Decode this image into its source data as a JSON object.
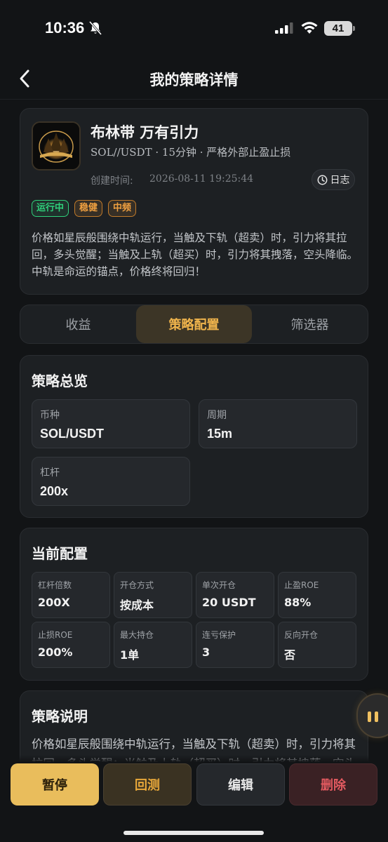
{
  "status_bar": {
    "time": "10:36",
    "battery": "41"
  },
  "nav": {
    "title": "我的策略详情"
  },
  "hero": {
    "title": "布林带 万有引力",
    "subtitle": "SOL//USDT · 15分钟 · 严格外部止盈止损",
    "created_label": "创建时间:",
    "created_value": "2026-08-11 19:25:44",
    "log_label": "日志",
    "tags": [
      "运行中",
      "稳健",
      "中频"
    ],
    "description": "价格如星辰般围绕中轨运行，当触及下轨（超卖）时，引力将其拉回，多头觉醒；当触及上轨（超买）时，引力将其拽落，空头降临。中轨是命运的锚点，价格终将回归！"
  },
  "tabs": [
    "收益",
    "策略配置",
    "筛选器"
  ],
  "overview": {
    "title": "策略总览",
    "items": [
      {
        "label": "币种",
        "value": "SOL/USDT"
      },
      {
        "label": "周期",
        "value": "15m"
      },
      {
        "label": "杠杆",
        "value": "200x"
      }
    ]
  },
  "config": {
    "title": "当前配置",
    "items": [
      {
        "label": "杠杆倍数",
        "value": "200X"
      },
      {
        "label": "开仓方式",
        "value": "按成本"
      },
      {
        "label": "单次开仓",
        "value": "20 USDT"
      },
      {
        "label": "止盈ROE",
        "value": "88%"
      },
      {
        "label": "止损ROE",
        "value": "200%"
      },
      {
        "label": "最大持仓",
        "value": "1单"
      },
      {
        "label": "连亏保护",
        "value": "3"
      },
      {
        "label": "反向开仓",
        "value": "否"
      }
    ]
  },
  "explain": {
    "title": "策略说明",
    "description": "价格如星辰般围绕中轨运行，当触及下轨（超卖）时，引力将其拉回，多头觉醒；当触及上轨（超买）时，引力将其拽落，空头降临。"
  },
  "actions": {
    "pause": "暂停",
    "backtest": "回测",
    "edit": "编辑",
    "delete": "删除"
  },
  "colors": {
    "accent": "#f0b44c",
    "running": "#2fd07b",
    "danger": "#e35a60",
    "background": "#121416"
  }
}
